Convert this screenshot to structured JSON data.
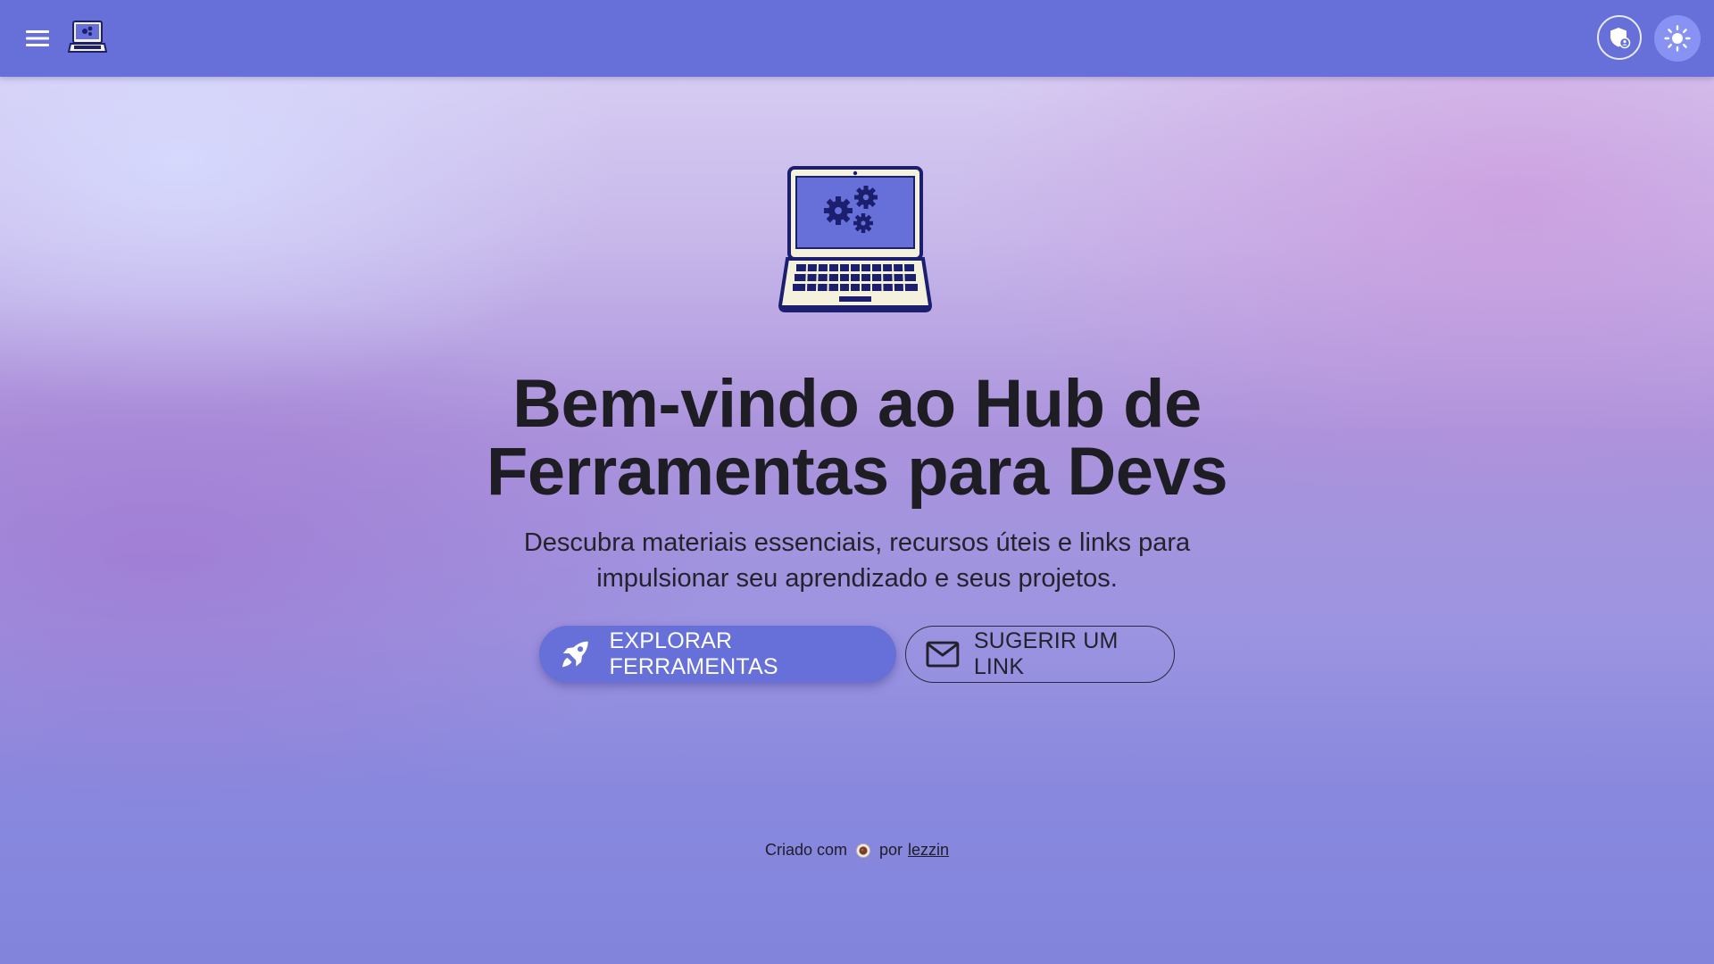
{
  "topbar": {
    "menu_icon": "menu-icon",
    "logo_icon": "laptop-gears-logo",
    "shield_icon": "admin-shield-icon",
    "theme_icon": "sun-icon",
    "accent_color": "#6670d8"
  },
  "hero": {
    "illustration_icon": "laptop-gears-illustration",
    "title": "Bem-vindo ao Hub de Ferramentas para Devs",
    "subtitle": "Descubra materiais essenciais, recursos úteis e links para impulsionar seu aprendizado e seus projetos.",
    "primary_button": {
      "icon": "rocket-icon",
      "label": "EXPLORAR FERRAMENTAS"
    },
    "secondary_button": {
      "icon": "mail-icon",
      "label": "SUGERIR UM LINK"
    }
  },
  "footer": {
    "prefix": "Criado com",
    "icon": "coffee-icon",
    "middle": "por",
    "author_link": "lezzin"
  }
}
